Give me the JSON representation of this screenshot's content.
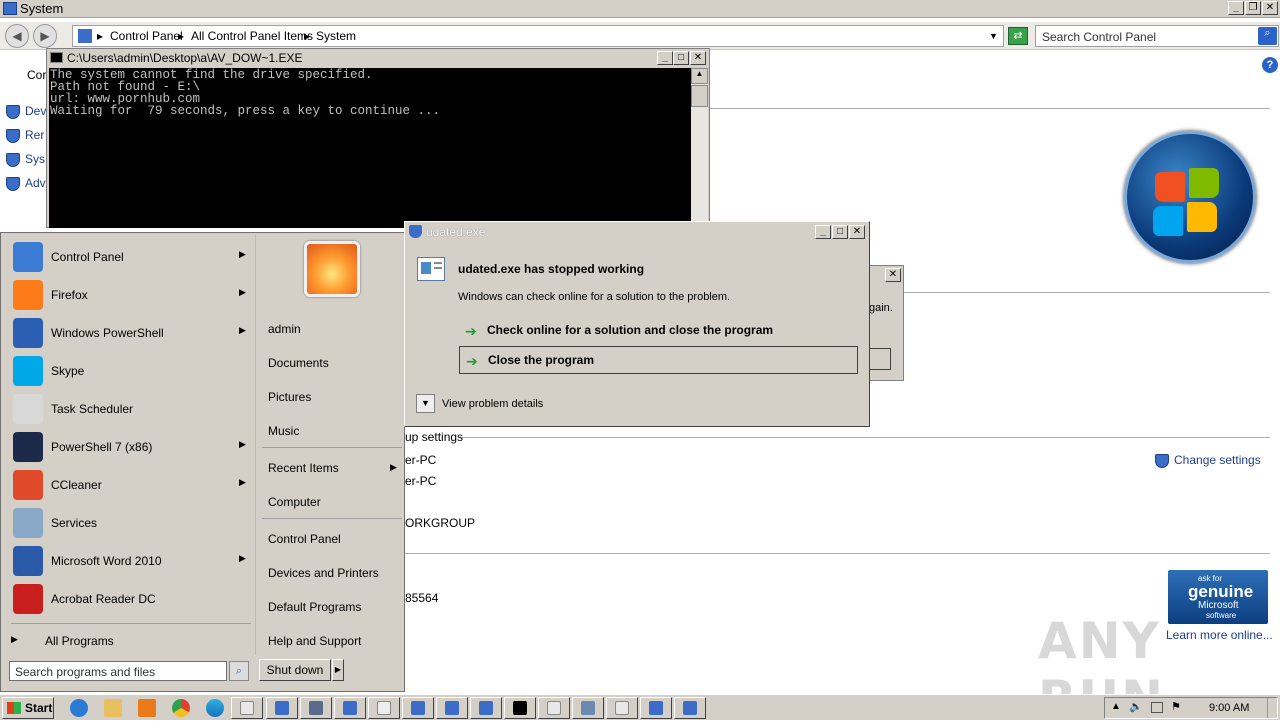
{
  "control_panel": {
    "title": "System",
    "breadcrumbs": [
      "Control Panel",
      "All Control Panel Items",
      "System"
    ],
    "search_placeholder": "Search Control Panel",
    "left_items": [
      "Dev",
      "Rer",
      "Sys",
      "Adv"
    ],
    "left_header": "Cor",
    "setup_settings": "up settings",
    "computer_name": "er-PC",
    "full_computer_name": "er-PC",
    "workgroup": "ORKGROUP",
    "product_id": "85564",
    "change_settings": "Change settings",
    "learn_more": "Learn more online...",
    "genuine": {
      "line1": "ask for",
      "line2": "genuine",
      "line3": "Microsoft",
      "line4": "software"
    },
    "partial_dialog_text": "gain."
  },
  "console": {
    "title": "C:\\Users\\admin\\Desktop\\a\\AV_DOW~1.EXE",
    "lines": [
      "The system cannot find the drive specified.",
      "Path not found - E:\\",
      "url: www.pornhub.com",
      "",
      "Waiting for  79 seconds, press a key to continue ..."
    ]
  },
  "start_menu": {
    "programs": [
      {
        "label": "Control Panel",
        "icon": "control-panel-icon",
        "color": "#3b7bd4",
        "arrow": true
      },
      {
        "label": "Firefox",
        "icon": "firefox-icon",
        "color": "#ff7a18",
        "arrow": true
      },
      {
        "label": "Windows PowerShell",
        "icon": "powershell-icon",
        "color": "#2b5fb4",
        "arrow": true
      },
      {
        "label": "Skype",
        "icon": "skype-icon",
        "color": "#00a8e8",
        "arrow": false
      },
      {
        "label": "Task Scheduler",
        "icon": "clock-icon",
        "color": "#d8d8d8",
        "arrow": false
      },
      {
        "label": "PowerShell 7 (x86)",
        "icon": "powershell7-icon",
        "color": "#1c2a4a",
        "arrow": true
      },
      {
        "label": "CCleaner",
        "icon": "ccleaner-icon",
        "color": "#e04a2a",
        "arrow": true
      },
      {
        "label": "Services",
        "icon": "gears-icon",
        "color": "#8aa8c8",
        "arrow": false
      },
      {
        "label": "Microsoft Word 2010",
        "icon": "word-icon",
        "color": "#2a5aa8",
        "arrow": true
      },
      {
        "label": "Acrobat Reader DC",
        "icon": "acrobat-icon",
        "color": "#c81e1e",
        "arrow": false
      }
    ],
    "all_programs": "All Programs",
    "search_placeholder": "Search programs and files",
    "right_items": [
      "admin",
      "Documents",
      "Pictures",
      "Music",
      "Recent Items",
      "Computer",
      "Control Panel",
      "Devices and Printers",
      "Default Programs",
      "Help and Support"
    ],
    "shutdown_label": "Shut down"
  },
  "error_dialog": {
    "title": "udated.exe",
    "headline": "udated.exe has stopped working",
    "subtext": "Windows can check online for a solution to the problem.",
    "option1": "Check online for a solution and close the program",
    "option2": "Close the program",
    "details": "View problem details"
  },
  "taskbar": {
    "start_label": "Start",
    "clock": "9:00 AM"
  },
  "watermark": "ANY RUN"
}
